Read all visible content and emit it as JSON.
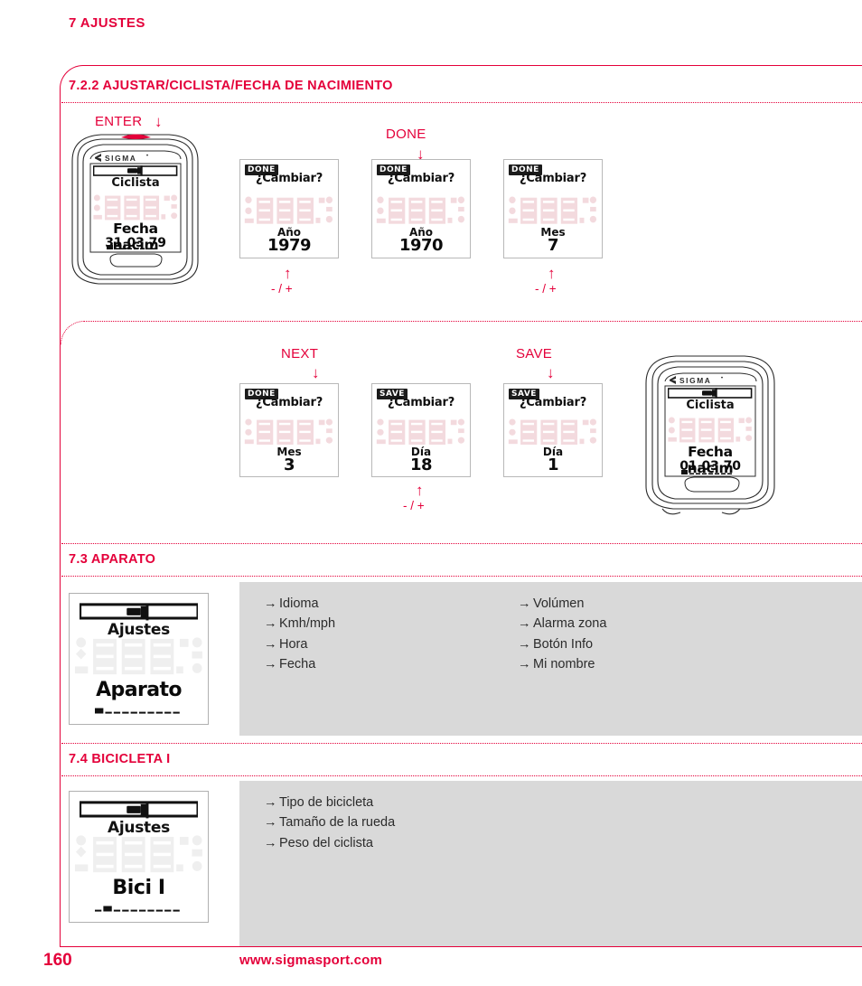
{
  "chapter": {
    "title": "7 AJUSTES"
  },
  "sections": [
    {
      "id": "s722",
      "heading": "7.2.2 AJUSTAR/CICLISTA/FECHA DE NACIMIENTO"
    },
    {
      "id": "s73",
      "heading": "7.3 APARATO"
    },
    {
      "id": "s74",
      "heading": "7.4 BICICLETA I"
    }
  ],
  "flow_row1": {
    "enter_label": "ENTER",
    "done_label": "DONE",
    "device": {
      "brand": "SIGMA",
      "sub_label": "Ciclista",
      "main_label": "Fecha nacim",
      "value": "31.03.79"
    },
    "screens": [
      {
        "chip": "DONE",
        "question": "¿Cambiar?",
        "unit": "Año",
        "value": "1979",
        "adjust": "- / +",
        "has_adjust": true
      },
      {
        "chip": "DONE",
        "question": "¿Cambiar?",
        "unit": "Año",
        "value": "1970",
        "adjust": "",
        "has_adjust": false
      },
      {
        "chip": "DONE",
        "question": "¿Cambiar?",
        "unit": "Mes",
        "value": "7",
        "adjust": "- / +",
        "has_adjust": true
      }
    ]
  },
  "flow_row2": {
    "next_label": "NEXT",
    "save_label": "SAVE",
    "device": {
      "brand": "SIGMA",
      "sub_label": "Ciclista",
      "main_label": "Fecha nacim",
      "value": "01.03.70"
    },
    "screens": [
      {
        "chip": "DONE",
        "question": "¿Cambiar?",
        "unit": "Mes",
        "value": "3",
        "adjust": "",
        "has_adjust": false
      },
      {
        "chip": "SAVE",
        "question": "¿Cambiar?",
        "unit": "Día",
        "value": "18",
        "adjust": "- / +",
        "has_adjust": true
      },
      {
        "chip": "SAVE",
        "question": "¿Cambiar?",
        "unit": "Día",
        "value": "1",
        "adjust": "",
        "has_adjust": false
      }
    ]
  },
  "aparato": {
    "lcd": {
      "sub_label": "Ajustes",
      "main_label": "Aparato"
    },
    "items_left": [
      "Idioma",
      "Kmh/mph",
      "Hora",
      "Fecha"
    ],
    "items_right": [
      "Volúmen",
      "Alarma zona",
      "Botón Info",
      "Mi nombre"
    ]
  },
  "bicicleta": {
    "lcd": {
      "sub_label": "Ajustes",
      "main_label": "Bici I"
    },
    "items_left": [
      "Tipo de bicicleta",
      "Tamaño de la rueda",
      "Peso del ciclista"
    ],
    "items_right": []
  },
  "footer": {
    "page_number": "160",
    "website": "www.sigmasport.com"
  },
  "colors": {
    "accent": "#E4003A",
    "panel_gray": "#d9d9d9",
    "lcd_border": "#b8b8b8",
    "ghost": "#f0d7dc"
  },
  "glyphs": {
    "arrow_down": "↓",
    "arrow_up": "↑",
    "bullet_arrow": "→"
  }
}
